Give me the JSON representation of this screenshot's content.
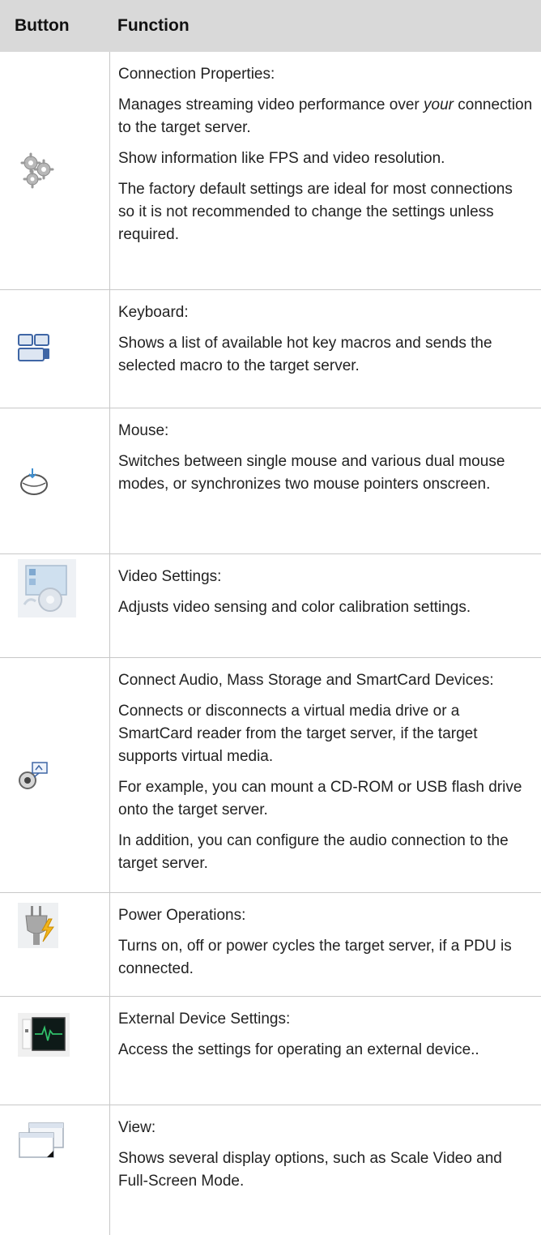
{
  "table": {
    "headers": {
      "button": "Button",
      "function": "Function"
    },
    "rows": [
      {
        "icon": "gears-icon",
        "title": "Connection Properties:",
        "para1_pre": "Manages streaming video performance over ",
        "para1_em": "your",
        "para1_post": " connection to the target server.",
        "para2": "Show information like FPS and video resolution.",
        "para3": "The factory default settings are ideal for most connections so it is not recommended to change the settings unless required."
      },
      {
        "icon": "keyboard-icon",
        "title": "Keyboard:",
        "para1": "Shows a list of available hot key macros and sends the selected macro to the target server."
      },
      {
        "icon": "mouse-icon",
        "title": "Mouse:",
        "para1": "Switches between single mouse and various dual mouse modes, or synchronizes two mouse pointers onscreen."
      },
      {
        "icon": "video-settings-icon",
        "title": "Video Settings:",
        "para1": "Adjusts video sensing and color calibration settings."
      },
      {
        "icon": "virtual-media-icon",
        "title": "Connect Audio, Mass Storage and SmartCard Devices:",
        "para1": "Connects or disconnects a virtual media drive or a SmartCard reader from the target server, if the target supports virtual media.",
        "para2": "For example, you can mount a CD-ROM or USB flash drive onto the target server.",
        "para3": "In addition, you can configure the audio connection to the target server."
      },
      {
        "icon": "power-plug-icon",
        "title": "Power Operations:",
        "para1": "Turns on, off or power cycles the target server, if a PDU is connected."
      },
      {
        "icon": "external-device-icon",
        "title": "External Device Settings:",
        "para1": "Access the settings for operating an external device.."
      },
      {
        "icon": "view-windows-icon",
        "title": "View:",
        "para1": "Shows several display options, such as Scale Video and Full-Screen Mode."
      }
    ]
  }
}
